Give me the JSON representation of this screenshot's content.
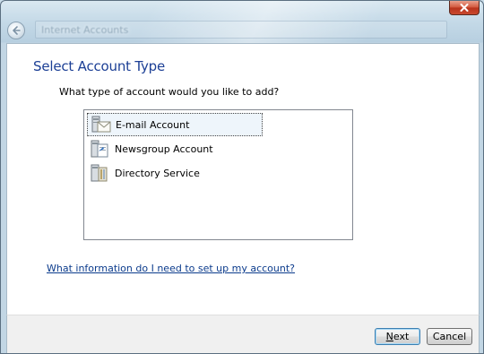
{
  "window": {
    "title": "Internet Accounts"
  },
  "page": {
    "heading": "Select Account Type",
    "prompt": "What type of account would you like to add?"
  },
  "account_types": [
    {
      "label": "E-mail Account",
      "icon": "email-account-icon",
      "selected": true
    },
    {
      "label": "Newsgroup Account",
      "icon": "newsgroup-account-icon",
      "selected": false
    },
    {
      "label": "Directory Service",
      "icon": "directory-service-icon",
      "selected": false
    }
  ],
  "help_link": "What information do I need to set up my account?",
  "buttons": {
    "next_first": "N",
    "next_rest": "ext",
    "cancel": "Cancel"
  },
  "colors": {
    "heading": "#1c3f95",
    "link": "#0b3b8c",
    "selection_background": "#eef5fb",
    "close_button": "#c94a2f"
  }
}
